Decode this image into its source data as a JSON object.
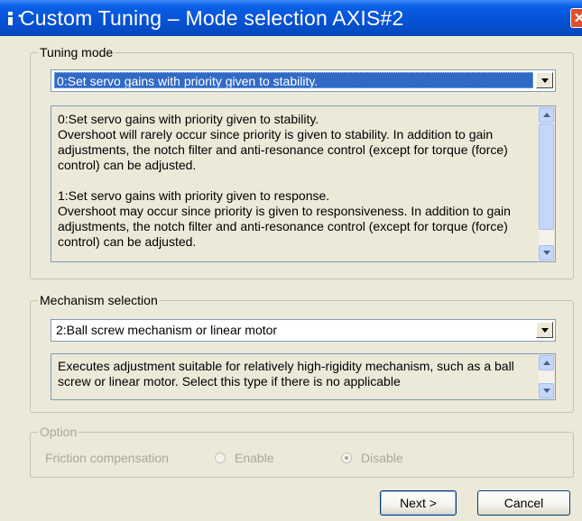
{
  "window": {
    "title": "Custom Tuning – Mode selection AXIS#2",
    "close_glyph": "✕"
  },
  "tuning_mode": {
    "group_label": "Tuning mode",
    "selected": "0:Set servo gains with priority given to stability.",
    "description_1": "0:Set servo gains with priority given to stability.\nOvershoot will rarely occur since priority is given to stability. In addition to gain adjustments, the notch filter and anti-resonance control (except for torque (force) control) can be adjusted.",
    "description_2": "1:Set servo gains with priority given to response.\nOvershoot may occur since priority is given to responsiveness. In addition to gain adjustments, the notch filter and anti-resonance control (except for torque (force) control) can be adjusted."
  },
  "mechanism": {
    "group_label": "Mechanism selection",
    "selected": "2:Ball screw mechanism or linear motor",
    "description": "Executes adjustment suitable for relatively high-rigidity mechanism, such as a ball screw or linear motor. Select this type if there is no applicable"
  },
  "option": {
    "group_label": "Option",
    "friction_label": "Friction compensation",
    "enable_label": "Enable",
    "disable_label": "Disable",
    "selected": "Disable"
  },
  "buttons": {
    "next_label": "Next >",
    "cancel_label": "Cancel"
  },
  "colors": {
    "title_bar": "#0651d4",
    "selection": "#316ac5",
    "disabled_text": "#aca899",
    "dialog_bg": "#ece9d8"
  },
  "icons": [
    "app-icon",
    "close-icon",
    "dropdown-arrow-icon",
    "scroll-up-icon",
    "scroll-down-icon"
  ]
}
